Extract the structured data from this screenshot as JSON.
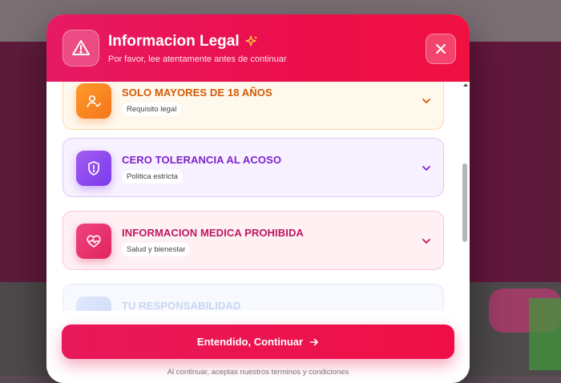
{
  "header": {
    "title": "Informacion Legal",
    "subtitle": "Por favor, lee atentamente antes de continuar",
    "icon": "warning-triangle-icon",
    "sparkle_icon": "sparkle-icon",
    "close_icon": "close-icon"
  },
  "cards": [
    {
      "title": "SOLO MAYORES DE 18 AÑOS",
      "tag": "Requisito legal",
      "icon": "user-check-icon",
      "accent": "#f3751b"
    },
    {
      "title": "CERO TOLERANCIA AL ACOSO",
      "tag": "Politica estricta",
      "icon": "shield-alert-icon",
      "accent": "#7c3aed"
    },
    {
      "title": "INFORMACION MEDICA PROHIBIDA",
      "tag": "Salud y bienestar",
      "icon": "heart-pulse-icon",
      "accent": "#e0245f"
    },
    {
      "title": "TU RESPONSABILIDAD",
      "tag": "",
      "icon": "info-icon",
      "accent": "#a8c0f6"
    }
  ],
  "footer": {
    "button_label": "Entendido, Continuar",
    "note": "Al continuar, aceptas nuestros terminos y condiciones"
  },
  "colors": {
    "primary": "#ec0e4b",
    "header_gradient_start": "#e61a63"
  }
}
